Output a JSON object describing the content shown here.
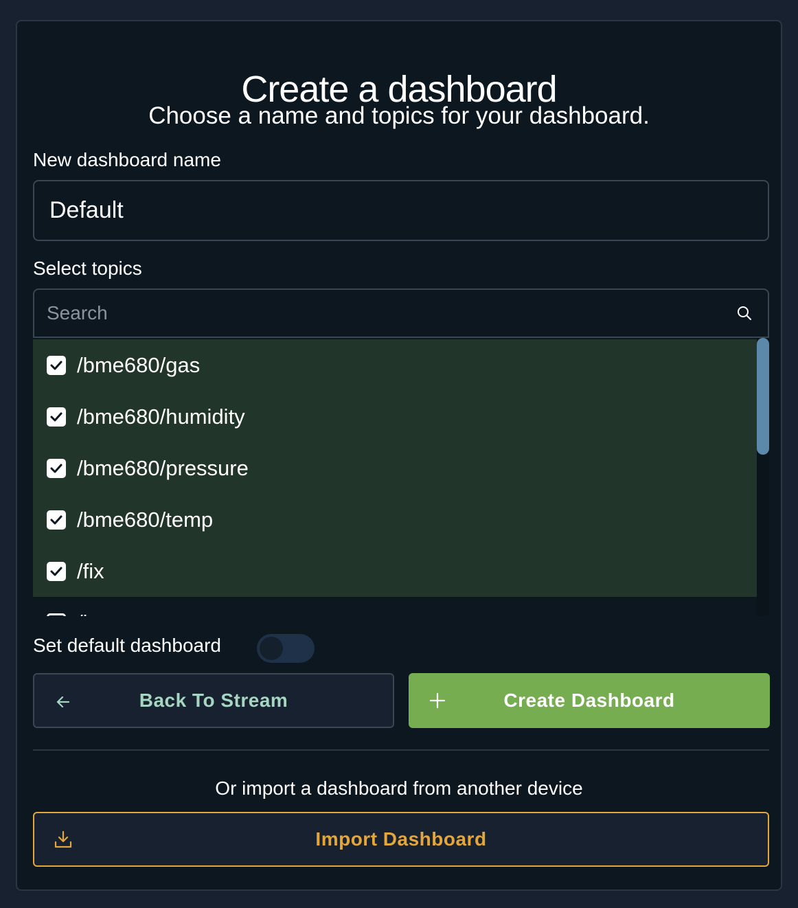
{
  "page": {
    "title": "Create a dashboard",
    "subtitle": "Choose a name and topics for your dashboard."
  },
  "name_field": {
    "label": "New dashboard name",
    "value": "Default"
  },
  "topics": {
    "label": "Select topics",
    "search_placeholder": "Search",
    "scroll_position": 0,
    "items": [
      {
        "label": "/bme680/gas",
        "checked": true
      },
      {
        "label": "/bme680/humidity",
        "checked": true
      },
      {
        "label": "/bme680/pressure",
        "checked": true
      },
      {
        "label": "/bme680/temp",
        "checked": true
      },
      {
        "label": "/fix",
        "checked": true
      },
      {
        "label": "/logs",
        "checked": false
      }
    ]
  },
  "default_toggle": {
    "label": "Set default dashboard",
    "on": false
  },
  "buttons": {
    "back_label": "Back To Stream",
    "create_label": "Create Dashboard",
    "import_label": "Import Dashboard"
  },
  "import_section": {
    "text": "Or import a dashboard from another device"
  },
  "colors": {
    "background": "#17212f",
    "card": "#0d1720",
    "selected_row": "#21352a",
    "create_button": "#76ad51",
    "import_accent": "#e4a63b",
    "back_text": "#a6d6c2",
    "scrollbar_thumb": "#5c89a9"
  }
}
